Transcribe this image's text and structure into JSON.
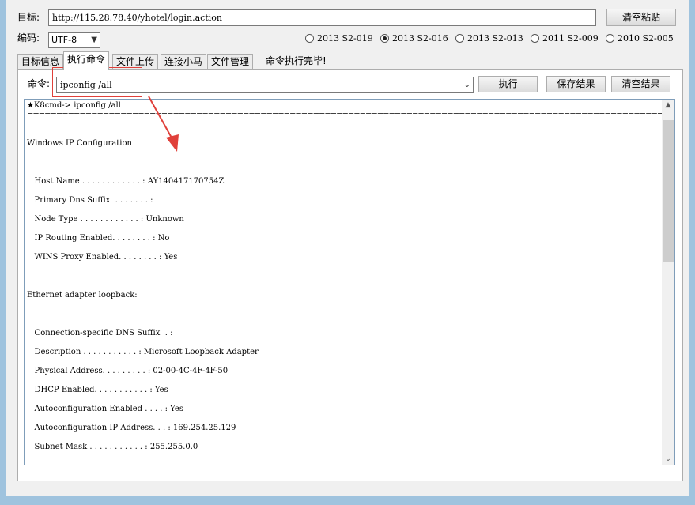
{
  "target": {
    "label": "目标:",
    "value": "http://115.28.78.40/yhotel/login.action",
    "clear_button": "清空粘贴"
  },
  "encoding": {
    "label": "编码:",
    "value": "UTF-8"
  },
  "versions": [
    {
      "label": "2013 S2-019",
      "selected": false
    },
    {
      "label": "2013 S2-016",
      "selected": true
    },
    {
      "label": "2013 S2-013",
      "selected": false
    },
    {
      "label": "2011 S2-009",
      "selected": false
    },
    {
      "label": "2010 S2-005",
      "selected": false
    }
  ],
  "tabs": [
    {
      "label": "目标信息",
      "active": false
    },
    {
      "label": "执行命令",
      "active": true
    },
    {
      "label": "文件上传",
      "active": false
    },
    {
      "label": "连接小马",
      "active": false
    },
    {
      "label": "文件管理",
      "active": false
    }
  ],
  "status_text": "命令执行完毕!",
  "command": {
    "label": "命令:",
    "value": "ipconfig /all",
    "execute_button": "执行",
    "save_button": "保存结果",
    "clear_button": "清空结果"
  },
  "console": {
    "prompt": "★K8cmd-> ipconfig /all",
    "separator": "==========================================================================================================================================",
    "lines": [
      "Windows IP Configuration",
      "   Host Name . . . . . . . . . . . . : AY140417170754Z",
      "   Primary Dns Suffix  . . . . . . . :",
      "   Node Type . . . . . . . . . . . . : Unknown",
      "   IP Routing Enabled. . . . . . . . : No",
      "   WINS Proxy Enabled. . . . . . . . : Yes",
      "Ethernet adapter loopback:",
      "   Connection-specific DNS Suffix  . :",
      "   Description . . . . . . . . . . . : Microsoft Loopback Adapter",
      "   Physical Address. . . . . . . . . : 02-00-4C-4F-4F-50",
      "   DHCP Enabled. . . . . . . . . . . : Yes",
      "   Autoconfiguration Enabled . . . . : Yes",
      "   Autoconfiguration IP Address. . . : 169.254.25.129",
      "   Subnet Mask . . . . . . . . . . . : 255.255.0.0"
    ]
  },
  "annotation_color": "#e0403a"
}
